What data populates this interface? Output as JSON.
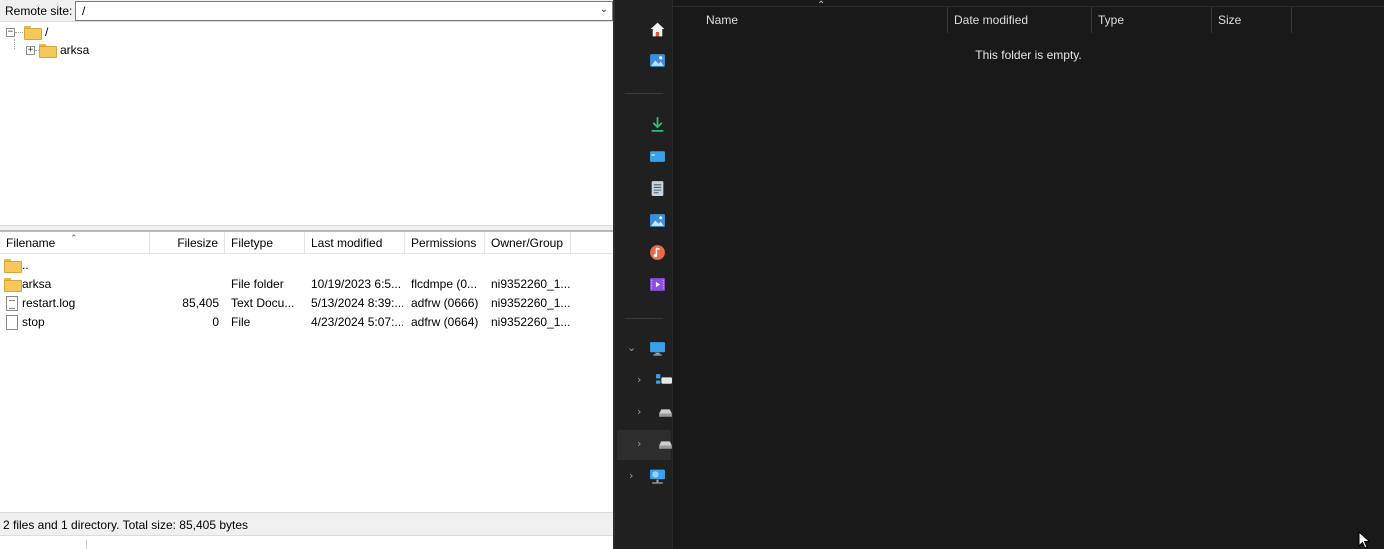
{
  "filezilla": {
    "site_label": "Remote site:",
    "site_path": "/",
    "tree": {
      "root": "/",
      "child": "arksa"
    },
    "columns": [
      "Filename",
      "Filesize",
      "Filetype",
      "Last modified",
      "Permissions",
      "Owner/Group"
    ],
    "rows": [
      {
        "name": "..",
        "size": "",
        "type": "",
        "modified": "",
        "perms": "",
        "owner": "",
        "icon": "folder-icon"
      },
      {
        "name": "arksa",
        "size": "",
        "type": "File folder",
        "modified": "10/19/2023 6:5...",
        "perms": "flcdmpe (0...",
        "owner": "ni9352260_1...",
        "icon": "folder-icon"
      },
      {
        "name": "restart.log",
        "size": "85,405",
        "type": "Text Docu...",
        "modified": "5/13/2024 8:39:...",
        "perms": "adfrw (0666)",
        "owner": "ni9352260_1...",
        "icon": "text-file-icon"
      },
      {
        "name": "stop",
        "size": "0",
        "type": "File",
        "modified": "4/23/2024 5:07:...",
        "perms": "adfrw (0664)",
        "owner": "ni9352260_1...",
        "icon": "file-icon"
      }
    ],
    "status": "2 files and 1 directory. Total size: 85,405 bytes"
  },
  "explorer": {
    "columns": [
      "Name",
      "Date modified",
      "Type",
      "Size"
    ],
    "empty_message": "This folder is empty.",
    "nav_icons": [
      "home-icon",
      "gallery-icon",
      "downloads-icon",
      "desktop-icon",
      "documents-icon",
      "pictures-icon",
      "music-icon",
      "videos-icon",
      "this-pc-icon",
      "network-drive-icon",
      "drive-icon",
      "drive-icon",
      "network-icon"
    ],
    "colors": {
      "background": "#191919",
      "nav": "#202020",
      "text": "#dedede"
    }
  }
}
